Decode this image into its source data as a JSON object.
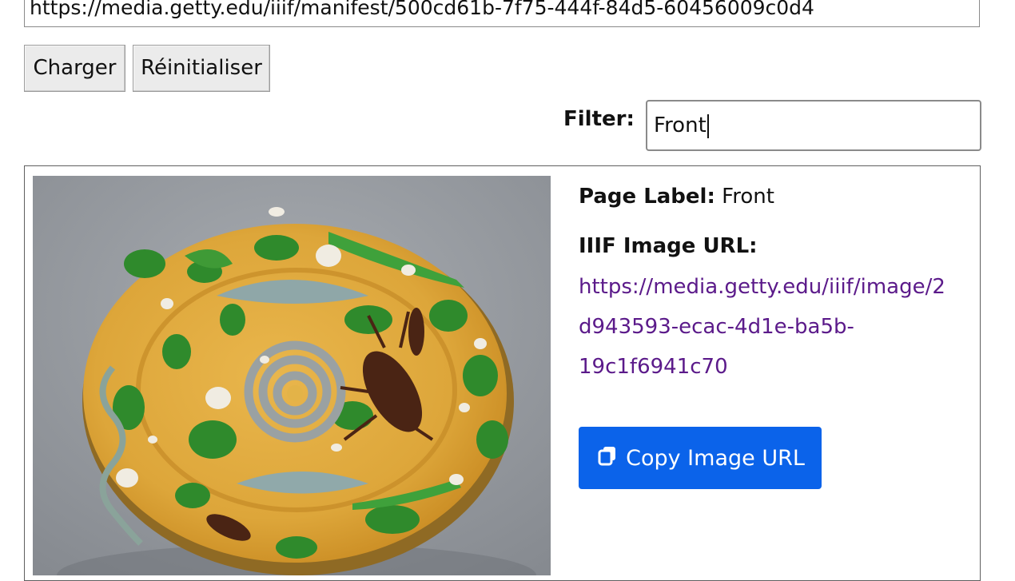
{
  "manifest": {
    "url_value": "https://media.getty.edu/iiif/manifest/500cd61b-7f75-444f-84d5-60456009c0d4"
  },
  "buttons": {
    "load_label": "Charger",
    "reset_label": "Réinitialiser"
  },
  "filter": {
    "label": "Filter:",
    "value": "Front"
  },
  "result": {
    "page_label_title": "Page Label:",
    "page_label_value": "Front",
    "iiif_heading": "IIIF Image URL:",
    "iiif_url": "https://media.getty.edu/iiif/image/2d943593-ecac-4d1e-ba5b-19c1f6941c70",
    "copy_button_label": "Copy Image URL",
    "copy_icon": "copy-icon"
  },
  "colors": {
    "button_primary": "#0b63ea",
    "link_visited": "#5b1a8a"
  }
}
